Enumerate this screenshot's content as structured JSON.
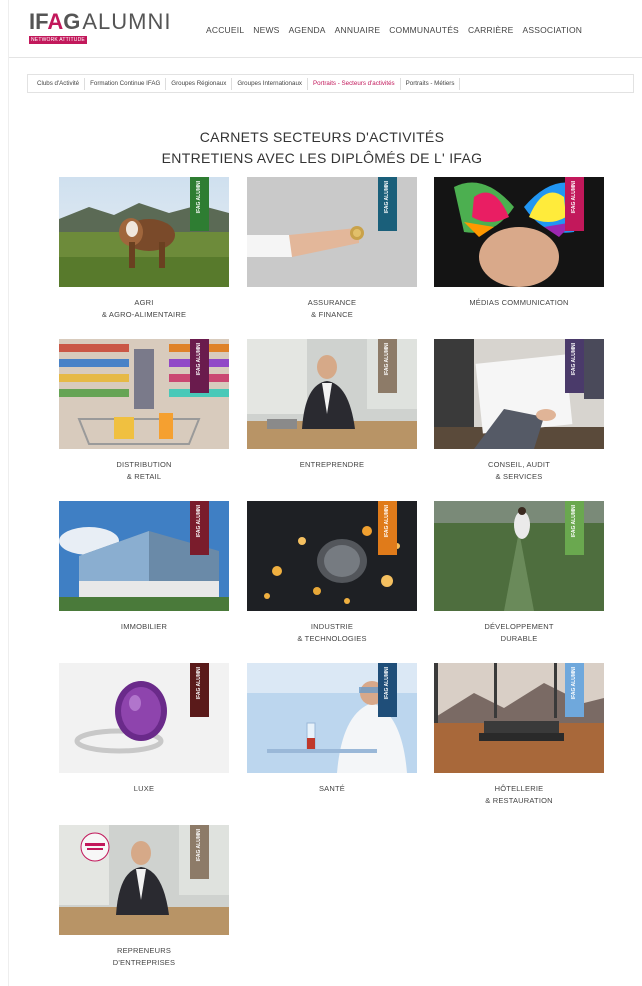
{
  "brand": {
    "logo_ifag": "IFAG",
    "logo_alumni": "ALUMNI",
    "logo_sub": "NETWORK ATTITUDE"
  },
  "nav": [
    "ACCUEIL",
    "NEWS",
    "AGENDA",
    "ANNUAIRE",
    "COMMUNAUTÉS",
    "CARRIÈRE",
    "ASSOCIATION"
  ],
  "subnav": [
    "Clubs d'Activité",
    "Formation Continue IFAG",
    "Groupes Régionaux",
    "Groupes Internationaux",
    "Portraits - Secteurs d'activités",
    "Portraits - Métiers"
  ],
  "subnav_active": "Portraits - Secteurs d'activités",
  "heading": {
    "line1": "CARNETS SECTEURS D'ACTIVITÉS",
    "line2": "ENTRETIENS AVEC LES DIPLÔMÉS DE L' IFAG"
  },
  "tag_text": "IFAG ALUMNI",
  "sectors": [
    {
      "line1": "AGRI",
      "line2": "& AGRO-ALIMENTAIRE",
      "tag_color": "#2e7d32",
      "image": "cow-in-meadow"
    },
    {
      "line1": "ASSURANCE",
      "line2": "& FINANCE",
      "tag_color": "#1a5f7a",
      "image": "hand-holding-coin"
    },
    {
      "line1": "MÉDIAS COMMUNICATION",
      "line2": "",
      "tag_color": "#c2185b",
      "image": "painted-hands"
    },
    {
      "line1": "DISTRIBUTION",
      "line2": "& RETAIL",
      "tag_color": "#6a1b4d",
      "image": "supermarket-cart"
    },
    {
      "line1": "ENTREPRENDRE",
      "line2": "",
      "tag_color": "#8d7b68",
      "image": "businessman-office"
    },
    {
      "line1": "CONSEIL, AUDIT",
      "line2": "& SERVICES",
      "tag_color": "#4a3a6a",
      "image": "signing-document"
    },
    {
      "line1": "IMMOBILIER",
      "line2": "",
      "tag_color": "#7a1c2c",
      "image": "glass-building"
    },
    {
      "line1": "INDUSTRIE",
      "line2": "& TECHNOLOGIES",
      "tag_color": "#e07b1a",
      "image": "light-bulb-bokeh"
    },
    {
      "line1": "DÉVELOPPEMENT",
      "line2": "DURABLE",
      "tag_color": "#6aa84f",
      "image": "person-in-field"
    },
    {
      "line1": "LUXE",
      "line2": "",
      "tag_color": "#5a1a1a",
      "image": "amethyst-ring"
    },
    {
      "line1": "SANTÉ",
      "line2": "",
      "tag_color": "#1f4e79",
      "image": "lab-scientist"
    },
    {
      "line1": "HÔTELLERIE",
      "line2": "& RESTAURATION",
      "tag_color": "#6fa8dc",
      "image": "hotel-bed-mountains"
    },
    {
      "line1": "REPRENEURS",
      "line2": "D'ENTREPRISES",
      "tag_color": "#8d7b68",
      "image": "businessman-office-badge"
    }
  ]
}
